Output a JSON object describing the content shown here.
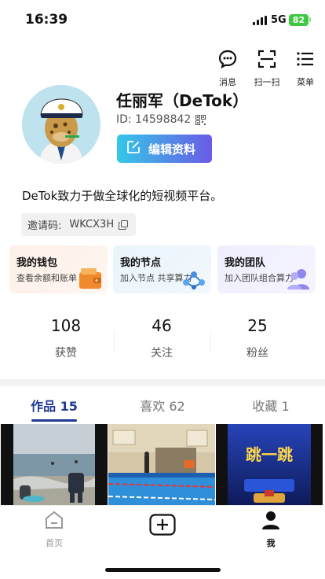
{
  "status_bar": {
    "time": "16:39",
    "network": "5G",
    "battery": "82"
  },
  "top_actions": [
    {
      "label": "消息",
      "icon": "message-icon"
    },
    {
      "label": "扫一扫",
      "icon": "scan-icon"
    },
    {
      "label": "菜单",
      "icon": "menu-icon"
    }
  ],
  "profile": {
    "name": "任丽军（DeTok）",
    "id_text": "ID: 14598842",
    "edit_label": "编辑资料",
    "bio": "DeTok致力于做全球化的短视频平台。",
    "invite_label": "邀请码:",
    "invite_code": "WKCX3H"
  },
  "cards": [
    {
      "title": "我的钱包",
      "subtitle": "查看余额和账单",
      "icon": "wallet-icon"
    },
    {
      "title": "我的节点",
      "subtitle": "加入节点 共享算力",
      "icon": "node-network-icon"
    },
    {
      "title": "我的团队",
      "subtitle": "加入团队组合算力",
      "icon": "team-icon"
    }
  ],
  "stats": [
    {
      "value": "108",
      "label": "获赞"
    },
    {
      "value": "46",
      "label": "关注"
    },
    {
      "value": "25",
      "label": "粉丝"
    }
  ],
  "tabs": [
    {
      "label": "作品 15"
    },
    {
      "label": "喜欢 62"
    },
    {
      "label": "收藏 1"
    }
  ],
  "thumbnails": {
    "third_text": "跳一跳"
  },
  "bottom_nav": [
    {
      "label": "首页",
      "icon": "home-icon"
    },
    {
      "label": "",
      "icon": "plus-icon"
    },
    {
      "label": "我",
      "icon": "profile-icon"
    }
  ],
  "colors": {
    "accent": "#1f3a93",
    "edit_gradient_start": "#34c7e8",
    "edit_gradient_end": "#6b5be6",
    "battery": "#3ec93e"
  }
}
